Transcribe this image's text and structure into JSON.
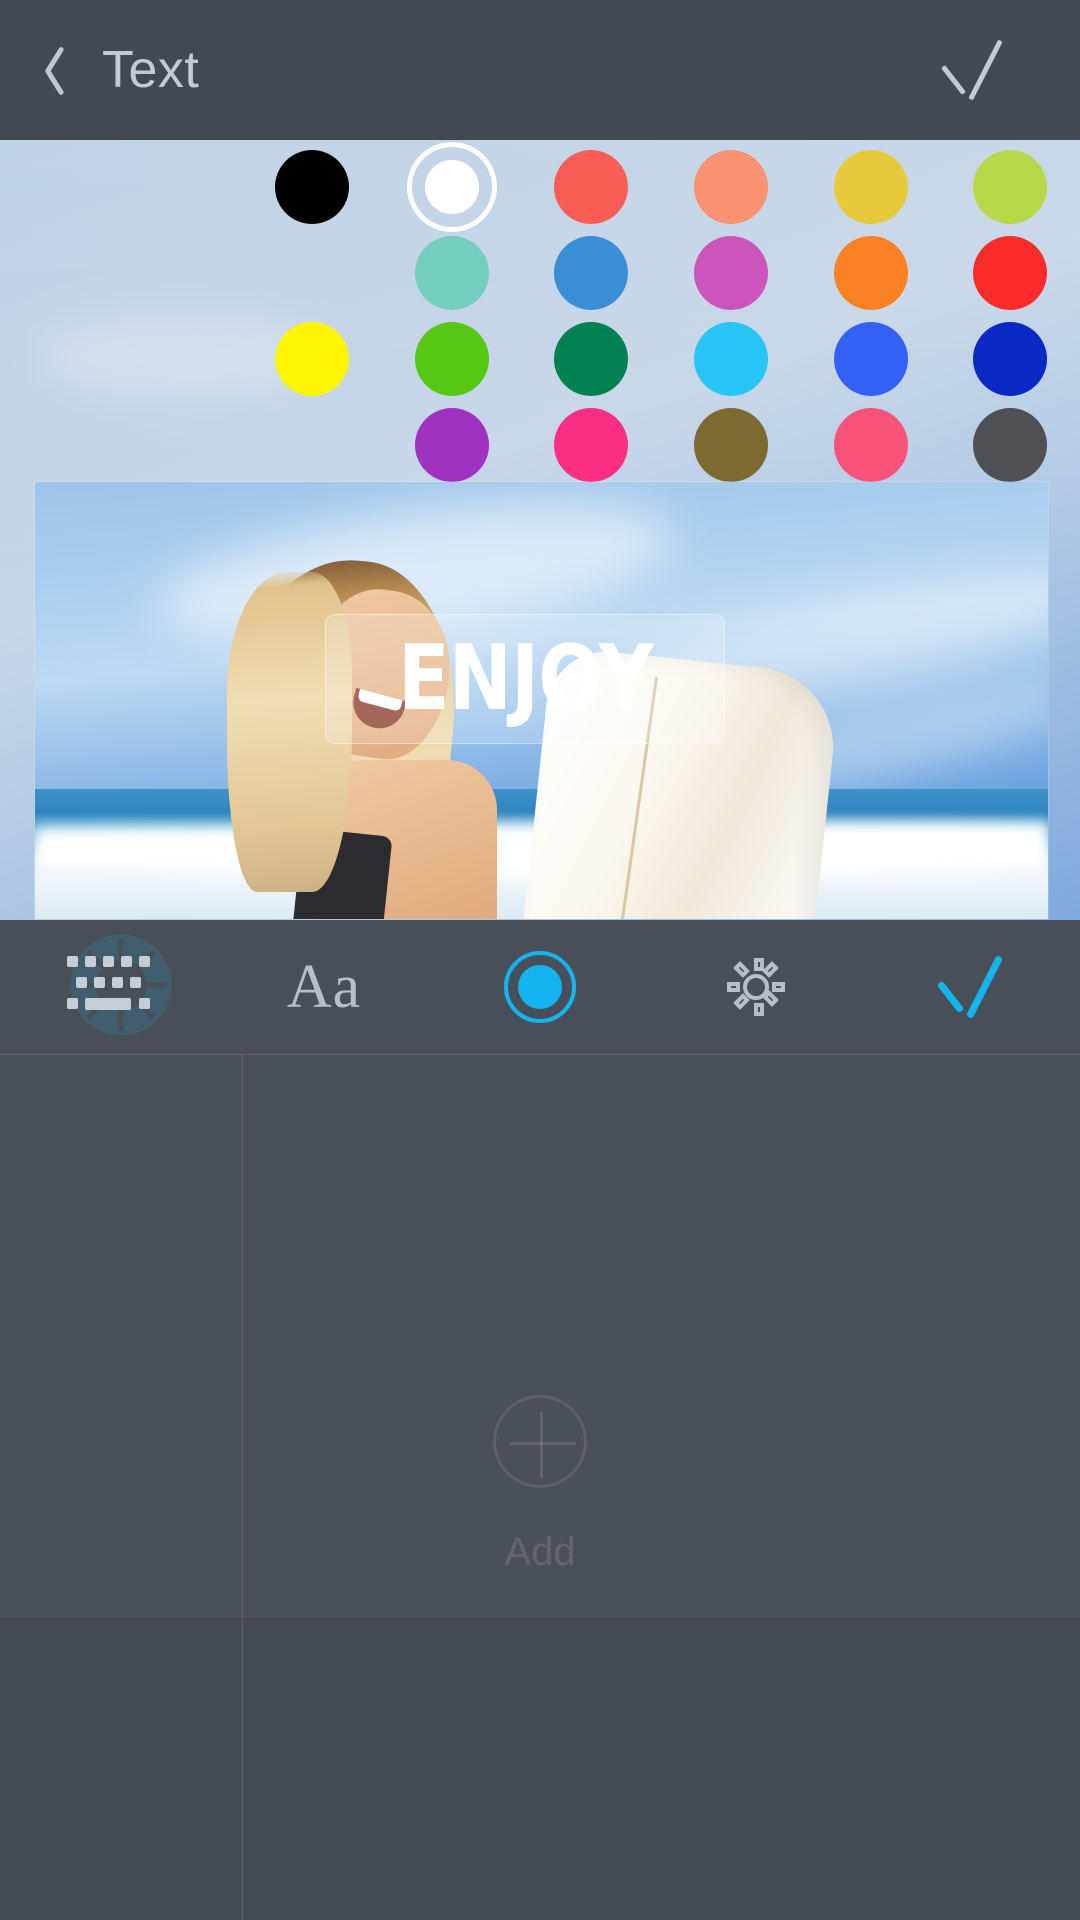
{
  "header": {
    "title": "Text",
    "back_icon": "chevron-left-icon",
    "confirm_icon": "check-icon"
  },
  "editor": {
    "photo_description": "woman with surfboard at beach",
    "text_overlay": {
      "value": "ENJOY"
    }
  },
  "toolbar": {
    "items": [
      {
        "name": "keyboard",
        "icon": "keyboard-icon",
        "label": "",
        "active": false
      },
      {
        "name": "font",
        "icon": "font-icon",
        "label": "Aa",
        "active": false
      },
      {
        "name": "color",
        "icon": "color-dot-icon",
        "label": "",
        "active": true
      },
      {
        "name": "settings",
        "icon": "gear-icon",
        "label": "",
        "active": false
      },
      {
        "name": "apply",
        "icon": "check-icon",
        "label": "",
        "active": false
      }
    ],
    "accent_color": "#13b5f1"
  },
  "options_panel": {
    "sidebar": [
      {
        "name": "color-wheel",
        "icon": "color-wheel-icon",
        "active": true,
        "color": "#13b5f1"
      },
      {
        "name": "pattern",
        "icon": "lattice-pattern-icon",
        "active": false,
        "color": "#c8ced6"
      }
    ],
    "selected_swatch": {
      "row": 0,
      "index": 1,
      "color": "#ffffff"
    },
    "swatch_rows": [
      {
        "offset": 0,
        "colors": [
          "#000000",
          "#ffffff",
          "#fa5d55",
          "#fb9272",
          "#e9c93c",
          "#b8d84a"
        ]
      },
      {
        "offset": 1,
        "colors": [
          "#74cec0",
          "#3a8fd4",
          "#cc55bb",
          "#fb8224",
          "#fa2b2b"
        ]
      },
      {
        "offset": 0,
        "colors": [
          "#fdf600",
          "#56c814",
          "#018152",
          "#29c5f6",
          "#3361f6",
          "#0a28c4"
        ]
      },
      {
        "offset": 1,
        "colors": [
          "#a032c1",
          "#fa2f84",
          "#7c6a31",
          "#f95379",
          "#4e5056"
        ]
      },
      {
        "offset": 0,
        "colors": [
          "#ec4ae0",
          "#cd852f",
          "#3ddf95",
          "#e9f777",
          "#38cfee",
          "#a6a6a6"
        ]
      }
    ],
    "add_button": {
      "label": "Add",
      "icon": "plus-circle-icon"
    }
  }
}
